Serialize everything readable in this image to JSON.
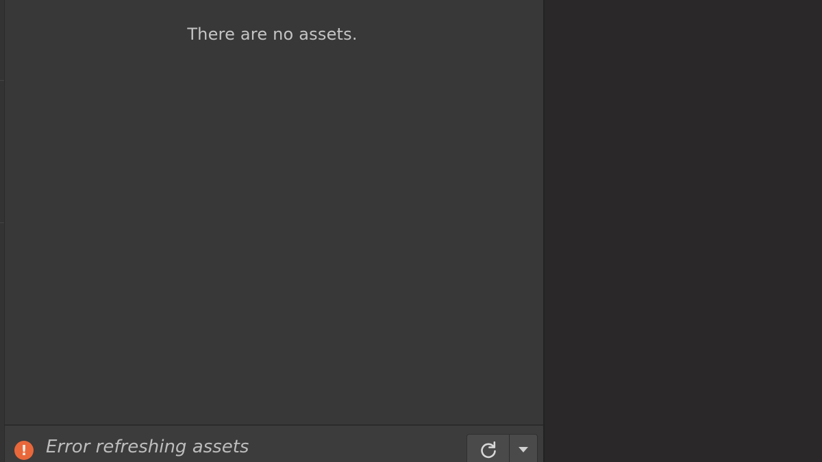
{
  "asset_panel": {
    "empty_message": "There are no assets."
  },
  "status_bar": {
    "error_icon_glyph": "!",
    "error_message": "Error refreshing assets",
    "icons": {
      "status": "error-icon",
      "refresh": "refresh-icon",
      "menu": "chevron-down-icon"
    },
    "colors": {
      "error": "#e8683b"
    }
  }
}
